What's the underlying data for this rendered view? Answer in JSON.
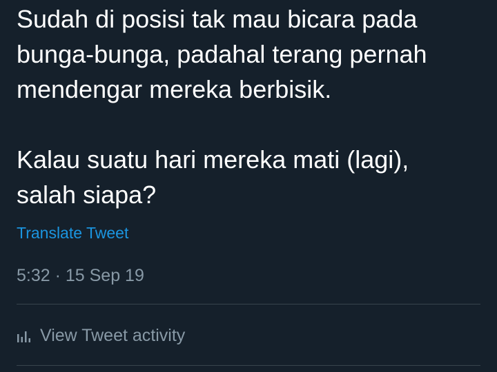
{
  "tweet": {
    "text": "Sudah di posisi tak mau bicara pada\nbunga-bunga, padahal terang pernah\nmendengar mereka berbisik.\n\nKalau suatu hari mereka mati (lagi),\nsalah siapa?",
    "translate_label": "Translate Tweet",
    "timestamp": "5:32 · 15 Sep 19"
  },
  "activity": {
    "label": "View Tweet activity",
    "icon": "bar-chart-icon"
  },
  "colors": {
    "background": "#15202b",
    "text_primary": "#ffffff",
    "text_secondary": "#8899a6",
    "link": "#1b95e0",
    "divider": "#38444d"
  }
}
